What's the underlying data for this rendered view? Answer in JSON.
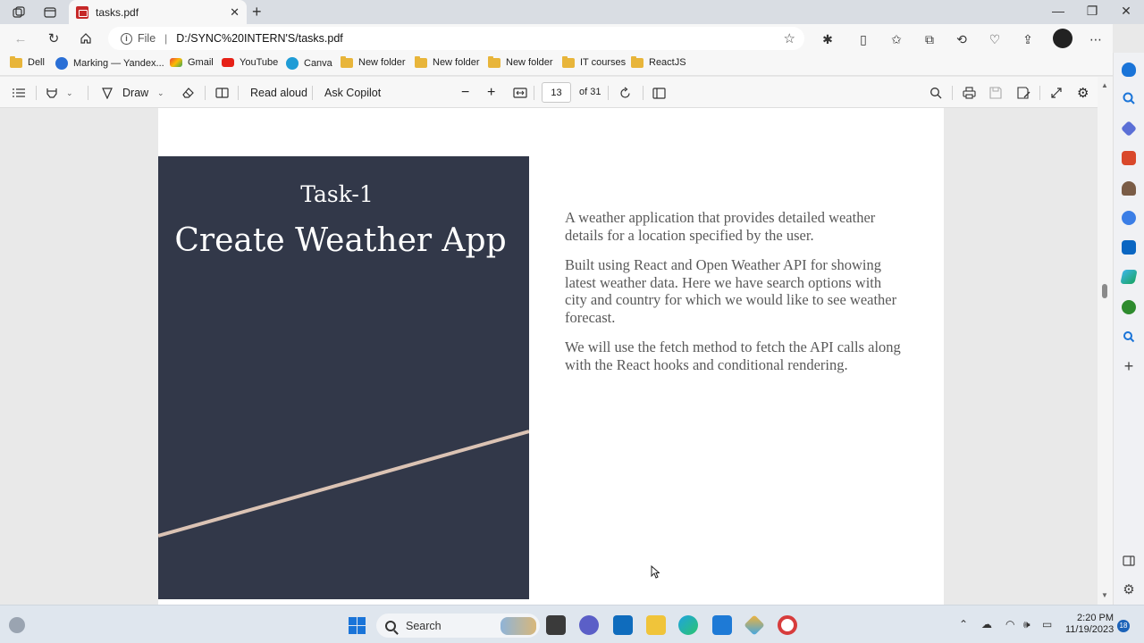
{
  "tab": {
    "title": "tasks.pdf"
  },
  "address": {
    "scheme": "File",
    "url": "D:/SYNC%20INTERN'S/tasks.pdf"
  },
  "bookmarks": [
    "Dell",
    "Marking — Yandex...",
    "Gmail",
    "YouTube",
    "Canva",
    "New folder",
    "New folder",
    "New folder",
    "IT courses",
    "ReactJS"
  ],
  "pdf_toolbar": {
    "draw": "Draw",
    "read_aloud": "Read aloud",
    "ask_copilot": "Ask Copilot",
    "page_number": "13",
    "page_total": "of 31"
  },
  "slide": {
    "task_label": "Task-1",
    "heading": "Create Weather App",
    "paragraphs": [
      "A weather application that provides detailed weather details for a location specified by the user.",
      "Built using React and Open Weather API for showing latest weather data. Here we have search options with city and country for which we would like to see weather forecast.",
      "We will use the fetch method to fetch the API calls along with the React hooks and conditional rendering."
    ]
  },
  "taskbar": {
    "search_label": "Search",
    "time": "2:20 PM",
    "date": "11/19/2023",
    "notification_count": "18"
  },
  "colors": {
    "slide_panel": "#323849",
    "slide_stripe": "#dbc3b4",
    "accent": "#1a74d8"
  }
}
